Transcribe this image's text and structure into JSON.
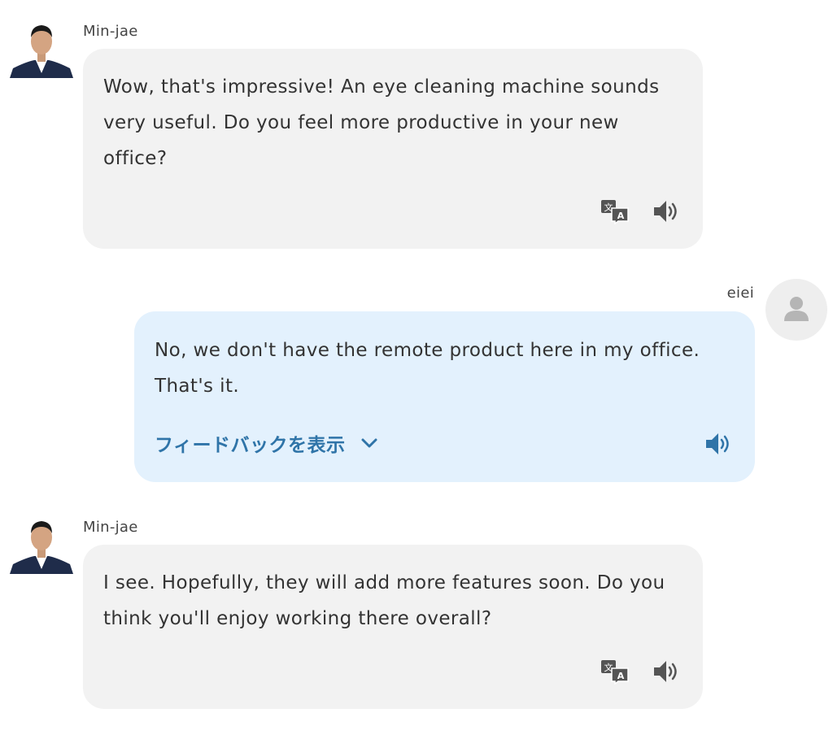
{
  "messages": [
    {
      "sender": "Min-jae",
      "text": "Wow, that's impressive! An eye cleaning machine sounds very useful. Do you feel more productive in your new office?",
      "actions": [
        "translate-icon",
        "speaker-icon"
      ]
    },
    {
      "sender": "eiei",
      "text": "No, we don't have the remote product here in my office. That's it.",
      "feedback_label": "フィードバックを表示",
      "actions": [
        "chevron-down-icon",
        "speaker-icon"
      ]
    },
    {
      "sender": "Min-jae",
      "text": "I see. Hopefully, they will add more features soon. Do you think you'll enjoy working there overall?",
      "actions": [
        "translate-icon",
        "speaker-icon"
      ]
    }
  ],
  "colors": {
    "bot_bubble": "#f2f2f2",
    "user_bubble": "#e3f1fd",
    "accent": "#2f74a8",
    "icon_gray": "#555555"
  }
}
